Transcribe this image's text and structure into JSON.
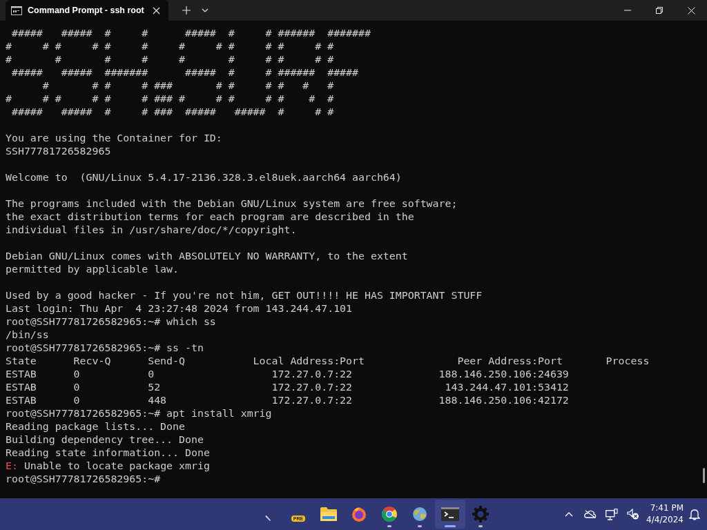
{
  "window": {
    "tabs": [
      {
        "title": "Command Prompt - ssh  root",
        "selected": true
      }
    ]
  },
  "terminal": {
    "lines": [
      {
        "kind": "output",
        "text": " #####   #####  #     #      #####  #     # ######  #######"
      },
      {
        "kind": "output",
        "text": "#     # #     # #     #     #     # #     # #     # #"
      },
      {
        "kind": "output",
        "text": "#       #       #     #     #       #     # #     # #"
      },
      {
        "kind": "output",
        "text": " #####   #####  #######      #####  #     # ######  #####"
      },
      {
        "kind": "output",
        "text": "      #       # #     # ###       # #     # #   #   #"
      },
      {
        "kind": "output",
        "text": "#     # #     # #     # ### #     # #     # #    #  #"
      },
      {
        "kind": "output",
        "text": " #####   #####  #     # ###  #####   #####  #     # #"
      },
      {
        "kind": "blank"
      },
      {
        "kind": "output",
        "text": "You are using the Container for ID:"
      },
      {
        "kind": "output",
        "text": "SSH77781726582965"
      },
      {
        "kind": "blank"
      },
      {
        "kind": "output",
        "text": "Welcome to  (GNU/Linux 5.4.17-2136.328.3.el8uek.aarch64 aarch64)"
      },
      {
        "kind": "blank"
      },
      {
        "kind": "output",
        "text": "The programs included with the Debian GNU/Linux system are free software;"
      },
      {
        "kind": "output",
        "text": "the exact distribution terms for each program are described in the"
      },
      {
        "kind": "output",
        "text": "individual files in /usr/share/doc/*/copyright."
      },
      {
        "kind": "blank"
      },
      {
        "kind": "output",
        "text": "Debian GNU/Linux comes with ABSOLUTELY NO WARRANTY, to the extent"
      },
      {
        "kind": "output",
        "text": "permitted by applicable law."
      },
      {
        "kind": "blank"
      },
      {
        "kind": "output",
        "text": "Used by a good hacker - If you're not him, GET OUT!!!! HE HAS IMPORTANT STUFF"
      },
      {
        "kind": "output",
        "text": "Last login: Thu Apr  4 23:27:48 2024 from 143.244.47.101"
      },
      {
        "kind": "output",
        "text": "root@SSH77781726582965:~# which ss"
      },
      {
        "kind": "output",
        "text": "/bin/ss"
      },
      {
        "kind": "output",
        "text": "root@SSH77781726582965:~# ss -tn"
      },
      {
        "kind": "output",
        "text": "State      Recv-Q      Send-Q           Local Address:Port               Peer Address:Port       Process"
      },
      {
        "kind": "output",
        "text": "ESTAB      0           0                   172.27.0.7:22              188.146.250.106:24639"
      },
      {
        "kind": "output",
        "text": "ESTAB      0           52                  172.27.0.7:22               143.244.47.101:53412"
      },
      {
        "kind": "output",
        "text": "ESTAB      0           448                 172.27.0.7:22              188.146.250.106:42172"
      },
      {
        "kind": "output",
        "text": "root@SSH77781726582965:~# apt install xmrig"
      },
      {
        "kind": "output",
        "text": "Reading package lists... Done"
      },
      {
        "kind": "output",
        "text": "Building dependency tree... Done"
      },
      {
        "kind": "output",
        "text": "Reading state information... Done"
      },
      {
        "kind": "error",
        "label": "E:",
        "text": " Unable to locate package xmrig"
      },
      {
        "kind": "output",
        "text": "root@SSH77781726582965:~#"
      }
    ]
  },
  "taskbar": {
    "apps": [
      {
        "kind": "pen",
        "running": false,
        "selected": false
      },
      {
        "kind": "badge",
        "label": "PRE",
        "running": false,
        "selected": false
      },
      {
        "kind": "folder",
        "running": false,
        "selected": false
      },
      {
        "kind": "firefox",
        "running": false,
        "selected": false
      },
      {
        "kind": "chrome",
        "running": true,
        "selected": false
      },
      {
        "kind": "globe",
        "running": true,
        "selected": false
      },
      {
        "kind": "terminal",
        "running": true,
        "selected": true
      },
      {
        "kind": "gear",
        "running": true,
        "selected": false
      }
    ],
    "clock": {
      "time": "7:41 PM",
      "date": "4/4/2024"
    }
  }
}
